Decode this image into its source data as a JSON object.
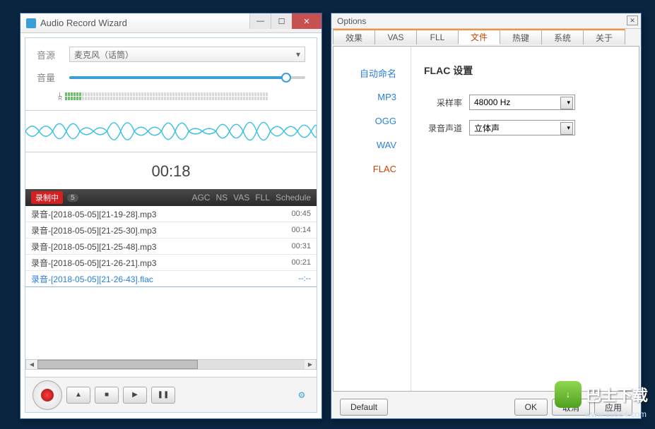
{
  "main": {
    "title": "Audio Record Wizard",
    "source_label": "音源",
    "source_value": "麦克风（话筒）",
    "volume_label": "音量",
    "level_lr": "L\nR",
    "timer": "00:18",
    "rec_status": "录制中",
    "rec_count": "5",
    "cols": {
      "agc": "AGC",
      "ns": "NS",
      "vas": "VAS",
      "fll": "FLL",
      "sched": "Schedule"
    },
    "recordings": [
      {
        "name": "录音-[2018-05-05][21-19-28].mp3",
        "time": "00:45"
      },
      {
        "name": "录音-[2018-05-05][21-25-30].mp3",
        "time": "00:14"
      },
      {
        "name": "录音-[2018-05-05][21-25-48].mp3",
        "time": "00:31"
      },
      {
        "name": "录音-[2018-05-05][21-26-21].mp3",
        "time": "00:21"
      },
      {
        "name": "录音-[2018-05-05][21-26-43].flac",
        "time": "--:--"
      }
    ]
  },
  "options": {
    "title": "Options",
    "tabs": [
      "效果",
      "VAS",
      "FLL",
      "文件",
      "热键",
      "系统",
      "关于"
    ],
    "active_tab": "文件",
    "subtabs": [
      "自动命名",
      "MP3",
      "OGG",
      "WAV",
      "FLAC"
    ],
    "active_subtab": "FLAC",
    "panel_title": "FLAC 设置",
    "sample_rate_label": "采样率",
    "sample_rate_value": "48000 Hz",
    "channel_label": "录音声道",
    "channel_value": "立体声",
    "buttons": {
      "default": "Default",
      "ok": "OK",
      "cancel": "取消",
      "apply": "应用"
    }
  },
  "watermark": {
    "text": "巴士下载",
    "url": "www.11684.com",
    "icon": "↓"
  }
}
